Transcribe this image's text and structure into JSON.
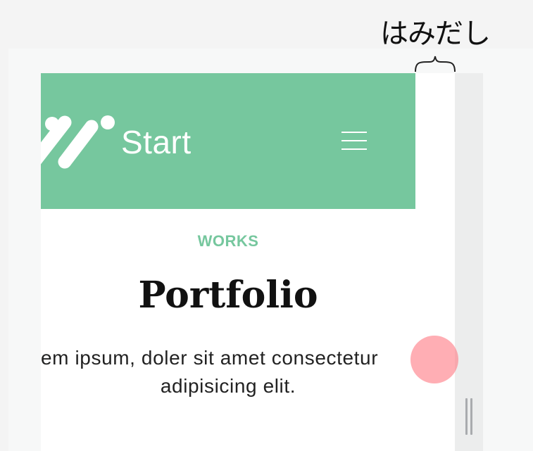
{
  "annotation": {
    "label": "はみだし"
  },
  "site": {
    "logo_text": "Start",
    "menu_icon": "hamburger-menu-icon"
  },
  "section": {
    "eyebrow": "WORKS",
    "title": "Portfolio",
    "lead_line_1": "em ipsum, doler sit amet consectetur",
    "lead_line_2": "adipisicing elit."
  },
  "colors": {
    "header_background": "#76c79e",
    "accent": "#76c79e",
    "touch_indicator": "#ff7882"
  }
}
